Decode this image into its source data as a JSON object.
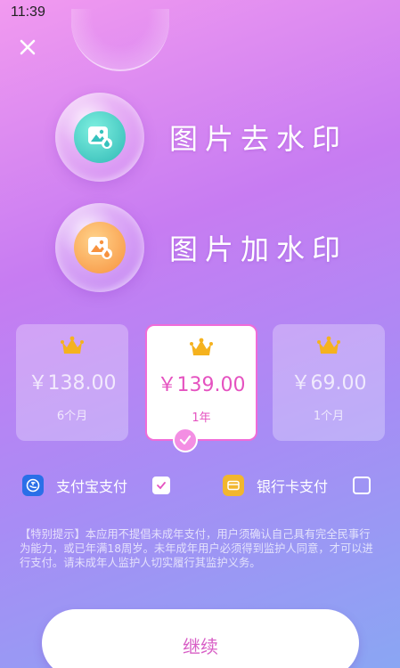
{
  "status_bar": {
    "time": "11:39"
  },
  "features": [
    {
      "label": "图片去水印",
      "icon": "image-remove-watermark-icon",
      "color": "#2fb8b5"
    },
    {
      "label": "图片加水印",
      "icon": "image-add-watermark-icon",
      "color": "#f7923e"
    }
  ],
  "plans": [
    {
      "price": "￥138.00",
      "period": "6个月",
      "selected": false
    },
    {
      "price": "￥139.00",
      "period": "1年",
      "selected": true
    },
    {
      "price": "￥69.00",
      "period": "1个月",
      "selected": false
    }
  ],
  "payment": {
    "alipay": {
      "label": "支付宝支付",
      "checked": true,
      "icon": "alipay-icon",
      "color": "#2a6fe8"
    },
    "bankcard": {
      "label": "银行卡支付",
      "checked": false,
      "icon": "bank-card-icon",
      "color": "#f2b62e"
    }
  },
  "notice": "【特别提示】本应用不提倡未成年支付，用户须确认自己具有完全民事行为能力，或已年满18周岁。未年成年用户必须得到监护人同意，才可以进行支付。请未成年人监护人切实履行其监护义务。",
  "continue_label": "继续",
  "colors": {
    "accent": "#e552c0",
    "crown": "#f5b21e"
  }
}
